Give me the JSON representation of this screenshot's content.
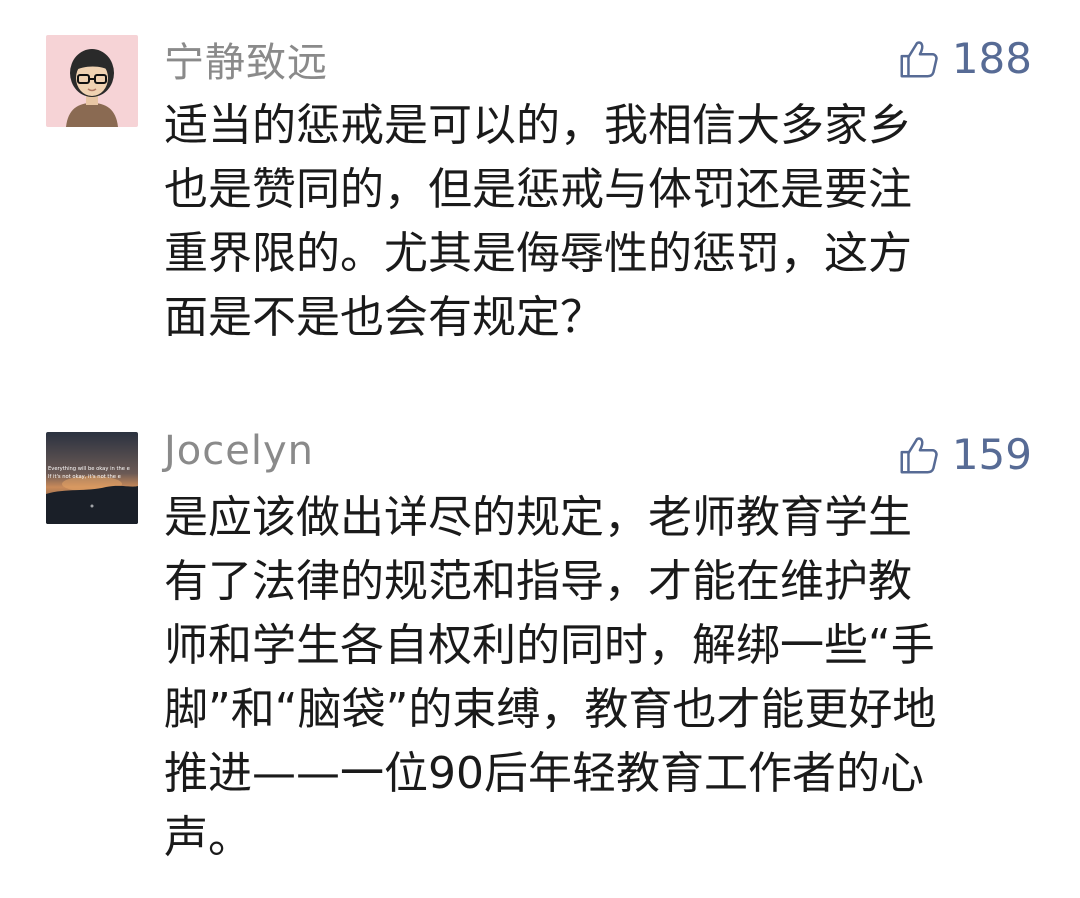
{
  "comments": [
    {
      "username": "宁静致远",
      "likes": "188",
      "avatar_icon": "cartoon-person-with-glasses",
      "lines": [
        "适当的惩戒是可以的，我相信大多家乡",
        "也是赞同的，但是惩戒与体罚还是要注",
        "重界限的。尤其是侮辱性的惩罚，这方",
        "面是不是也会有规定？"
      ]
    },
    {
      "username": "Jocelyn",
      "likes": "159",
      "avatar_icon": "sunset-landscape-quote-image",
      "avatar_text": [
        "Everything will be okay in the e",
        "If it's not okay, it's not the e"
      ],
      "lines": [
        "是应该做出详尽的规定，老师教育学生",
        "有了法律的规范和指导，才能在维护教",
        "师和学生各自权利的同时，解绑一些“手",
        "脚”和“脑袋”的束缚，教育也才能更好地",
        "推进——一位90后年轻教育工作者的心",
        "声。"
      ]
    }
  ],
  "colors": {
    "username": "#8a8a8a",
    "like_accent": "#576b95",
    "text": "#1a1a1a"
  }
}
